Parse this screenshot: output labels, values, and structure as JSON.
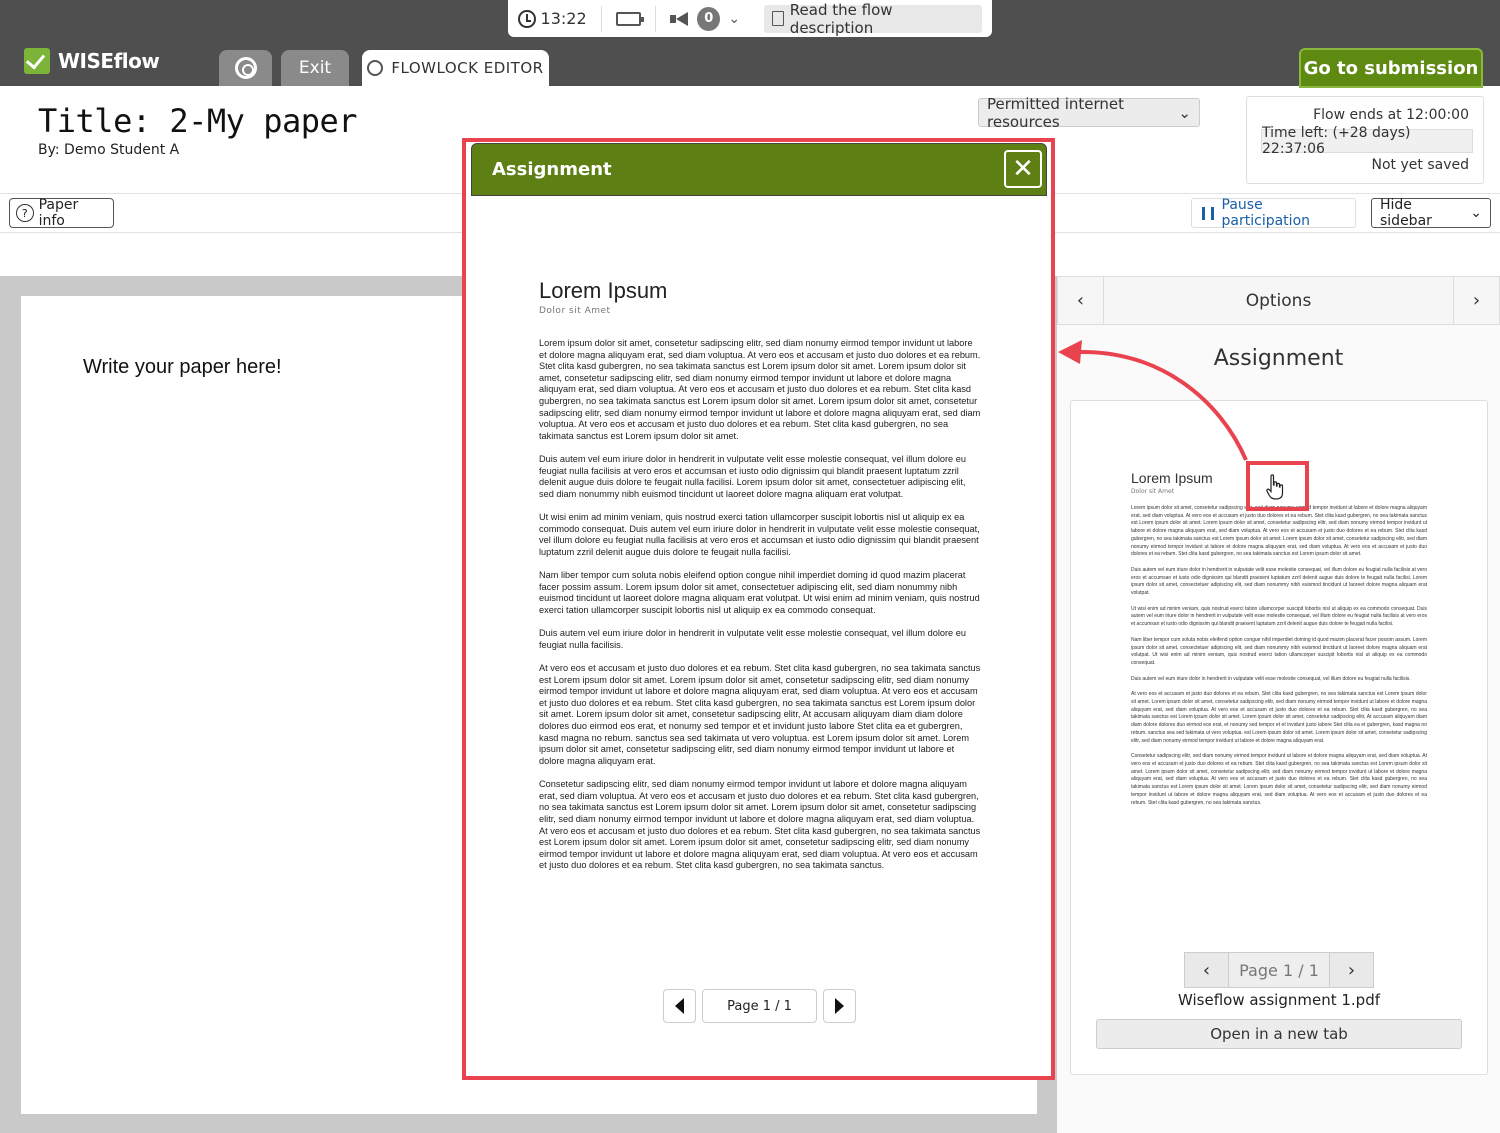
{
  "topbar": {
    "logo_text": "WISEflow",
    "exit_label": "Exit",
    "editor_tab_label": "FLOWLOCK EDITOR",
    "time": "13:22",
    "notification_count": "0",
    "flow_description_label": "Read the flow description",
    "submission_label": "Go to submission"
  },
  "header": {
    "title": "Title: 2-My paper",
    "by": "By: Demo Student A",
    "permitted_label": "Permitted internet resources",
    "flow_ends": "Flow ends at 12:00:00",
    "time_left": "Time left: (+28 days) 22:37:06",
    "save_status": "Not yet saved"
  },
  "toolbar": {
    "paper_info_label": "Paper info",
    "pause_label": "Pause participation",
    "hide_sidebar_label": "Hide sidebar"
  },
  "editor": {
    "content": "Write your paper here!"
  },
  "sidebar": {
    "options_label": "Options",
    "assignment_heading": "Assignment",
    "page_label": "Page 1 / 1",
    "file_name": "Wiseflow assignment 1.pdf",
    "open_tab_label": "Open in a new tab"
  },
  "modal": {
    "title": "Assignment",
    "close_glyph": "✕",
    "page_label": "Page 1 / 1"
  },
  "document": {
    "title": "Lorem Ipsum",
    "subtitle": "Dolor sit Amet",
    "paragraphs": [
      "Lorem ipsum dolor sit amet, consetetur sadipscing elitr, sed diam nonumy eirmod tempor invidunt ut labore et dolore magna aliquyam erat, sed diam voluptua. At vero eos et accusam et justo duo dolores et ea rebum. Stet clita kasd gubergren, no sea takimata sanctus est Lorem ipsum dolor sit amet. Lorem ipsum dolor sit amet, consetetur sadipscing elitr, sed diam nonumy eirmod tempor invidunt ut labore et dolore magna aliquyam erat, sed diam voluptua. At vero eos et accusam et justo duo dolores et ea rebum. Stet clita kasd gubergren, no sea takimata sanctus est Lorem ipsum dolor sit amet. Lorem ipsum dolor sit amet, consetetur sadipscing elitr, sed diam nonumy eirmod tempor invidunt ut labore et dolore magna aliquyam erat, sed diam voluptua. At vero eos et accusam et justo duo dolores et ea rebum. Stet clita kasd gubergren, no sea takimata sanctus est Lorem ipsum dolor sit amet.",
      "Duis autem vel eum iriure dolor in hendrerit in vulputate velit esse molestie consequat, vel illum dolore eu feugiat nulla facilisis at vero eros et accumsan et iusto odio dignissim qui blandit praesent luptatum zzril delenit augue duis dolore te feugait nulla facilisi. Lorem ipsum dolor sit amet, consectetuer adipiscing elit, sed diam nonummy nibh euismod tincidunt ut laoreet dolore magna aliquam erat volutpat.",
      "Ut wisi enim ad minim veniam, quis nostrud exerci tation ullamcorper suscipit lobortis nisl ut aliquip ex ea commodo consequat. Duis autem vel eum iriure dolor in hendrerit in vulputate velit esse molestie consequat, vel illum dolore eu feugiat nulla facilisis at vero eros et accumsan et iusto odio dignissim qui blandit praesent luptatum zzril delenit augue duis dolore te feugait nulla facilisi.",
      "Nam liber tempor cum soluta nobis eleifend option congue nihil imperdiet doming id quod mazim placerat facer possim assum. Lorem ipsum dolor sit amet, consectetuer adipiscing elit, sed diam nonummy nibh euismod tincidunt ut laoreet dolore magna aliquam erat volutpat. Ut wisi enim ad minim veniam, quis nostrud exerci tation ullamcorper suscipit lobortis nisl ut aliquip ex ea commodo consequat.",
      "Duis autem vel eum iriure dolor in hendrerit in vulputate velit esse molestie consequat, vel illum dolore eu feugiat nulla facilisis.",
      "At vero eos et accusam et justo duo dolores et ea rebum. Stet clita kasd gubergren, no sea takimata sanctus est Lorem ipsum dolor sit amet. Lorem ipsum dolor sit amet, consetetur sadipscing elitr, sed diam nonumy eirmod tempor invidunt ut labore et dolore magna aliquyam erat, sed diam voluptua. At vero eos et accusam et justo duo dolores et ea rebum. Stet clita kasd gubergren, no sea takimata sanctus est Lorem ipsum dolor sit amet. Lorem ipsum dolor sit amet, consetetur sadipscing elitr, At accusam aliquyam diam diam dolore dolores duo eirmod eos erat, et nonumy sed tempor et et invidunt justo labore Stet clita ea et gubergren, kasd magna no rebum. sanctus sea sed takimata ut vero voluptua. est Lorem ipsum dolor sit amet. Lorem ipsum dolor sit amet, consetetur sadipscing elitr, sed diam nonumy eirmod tempor invidunt ut labore et dolore magna aliquyam erat.",
      "Consetetur sadipscing elitr, sed diam nonumy eirmod tempor invidunt ut labore et dolore magna aliquyam erat, sed diam voluptua. At vero eos et accusam et justo duo dolores et ea rebum. Stet clita kasd gubergren, no sea takimata sanctus est Lorem ipsum dolor sit amet. Lorem ipsum dolor sit amet, consetetur sadipscing elitr, sed diam nonumy eirmod tempor invidunt ut labore et dolore magna aliquyam erat, sed diam voluptua. At vero eos et accusam et justo duo dolores et ea rebum. Stet clita kasd gubergren, no sea takimata sanctus est Lorem ipsum dolor sit amet. Lorem ipsum dolor sit amet, consetetur sadipscing elitr, sed diam nonumy eirmod tempor invidunt ut labore et dolore magna aliquyam erat, sed diam voluptua. At vero eos et accusam et justo duo dolores et ea rebum. Stet clita kasd gubergren, no sea takimata sanctus."
    ]
  },
  "colors": {
    "brand_green": "#5e7f13",
    "highlight_red": "#e8434f",
    "topbar_grey": "#4f4f4f",
    "link_blue": "#1a5fa8"
  }
}
